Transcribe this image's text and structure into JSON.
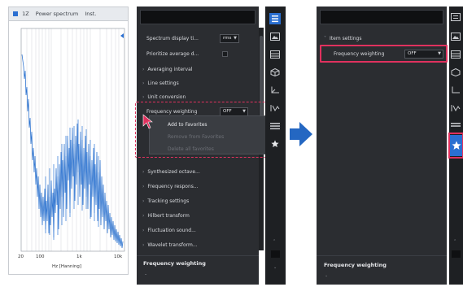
{
  "chart": {
    "title_prefix": "1Z",
    "title": "Power spectrum",
    "title_suffix": "Inst.",
    "x_ticks": [
      "20",
      "100",
      "1k",
      "10k"
    ],
    "x_label": "Hz [Hanning]"
  },
  "panel_left": {
    "items": [
      {
        "label": "Spectrum display ti...",
        "caret": ""
      },
      {
        "label": "Prioritize average d...",
        "caret": ""
      },
      {
        "label": "Averaging interval",
        "caret": "›"
      },
      {
        "label": "Line settings",
        "caret": "›"
      },
      {
        "label": "Unit conversion",
        "caret": "›"
      },
      {
        "label": "Frequency weighting",
        "caret": ""
      },
      {
        "label": "Synthesized octave...",
        "caret": "›"
      },
      {
        "label": "Frequency respons...",
        "caret": "›"
      },
      {
        "label": "Tracking settings",
        "caret": "›"
      },
      {
        "label": "Hilbert transform",
        "caret": "›"
      },
      {
        "label": "Fluctuation sound...",
        "caret": "›"
      },
      {
        "label": "Wavelet transform...",
        "caret": "›"
      }
    ],
    "spectrum_display_value": "rms",
    "freq_weighting_value": "OFF",
    "context_menu": {
      "add": "Add to Favorites",
      "remove": "Remove from Favorites",
      "delete_all": "Delete all favorites"
    },
    "bottom_title": "Frequency weighting",
    "bottom_value": "-"
  },
  "panel_right": {
    "group_label": "Item settings",
    "freq_weighting_label": "Frequency weighting",
    "freq_weighting_value": "OFF",
    "bottom_title": "Frequency weighting",
    "bottom_value": "-"
  },
  "colors": {
    "accent_blue": "#2a6fd1",
    "highlight": "#e0315e",
    "panel_bg": "#2b2d31",
    "toolbar_bg": "#1e2023"
  },
  "icons": {
    "toolbar": [
      "list-settings-icon",
      "image-icon",
      "layout-icon",
      "cube-icon",
      "axis-icon",
      "function-icon",
      "menu-icon",
      "star-icon"
    ]
  }
}
